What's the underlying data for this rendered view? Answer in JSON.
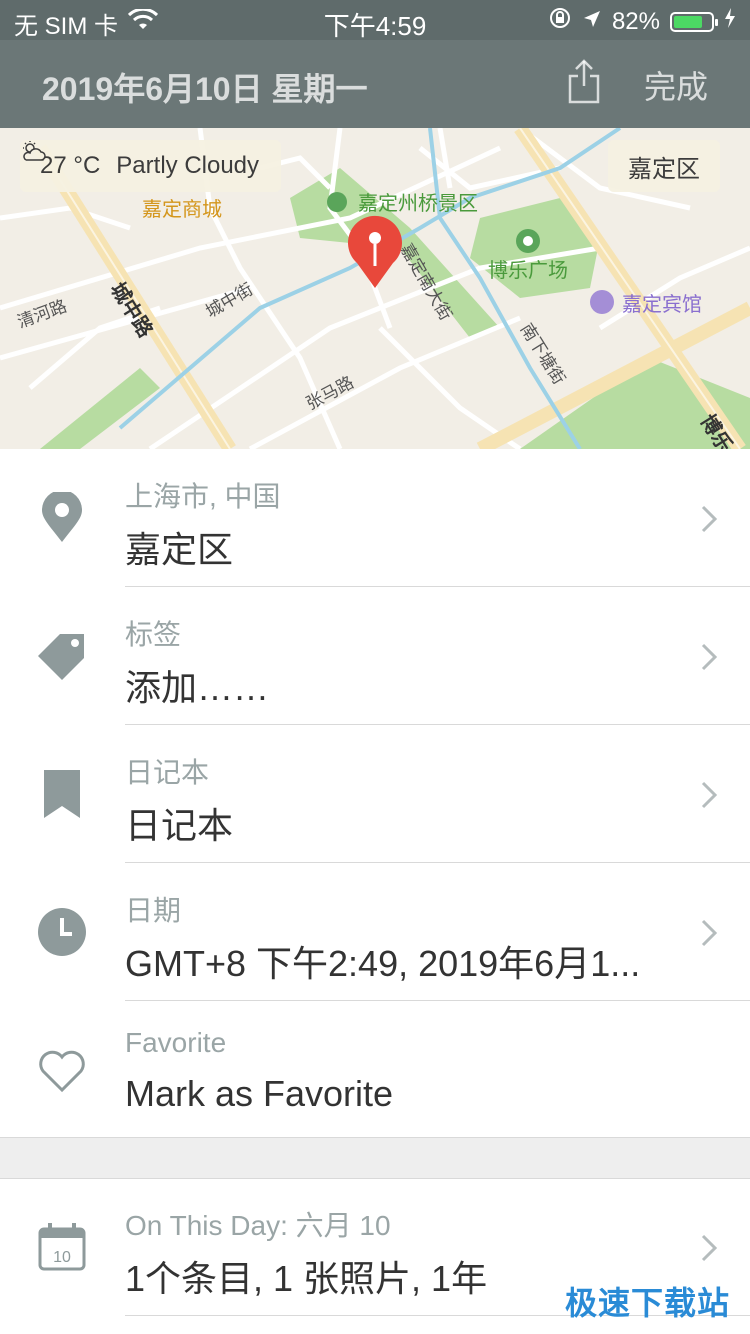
{
  "status_bar": {
    "carrier": "无 SIM 卡",
    "time": "下午4:59",
    "battery_percent": "82%",
    "battery_level": 0.82
  },
  "nav": {
    "title": "2019年6月10日 星期一",
    "done_label": "完成",
    "share_icon": "share-icon"
  },
  "map": {
    "weather": {
      "temperature": "27 °C",
      "condition": "Partly Cloudy",
      "icon": "partly-cloudy-icon"
    },
    "region_label": "嘉定区",
    "labels": {
      "mall": "嘉定商城",
      "scenic": "嘉定州桥景区",
      "square": "博乐广场",
      "hotel": "嘉定宾馆",
      "road_qinghe": "清河路",
      "road_chengzhong": "城中路",
      "street_chengzhong": "城中街",
      "street_jiadingnan": "嘉定南大街",
      "street_nanxiatang": "南下塘街",
      "road_zhangma": "张马路",
      "road_bole": "博乐"
    }
  },
  "rows": [
    {
      "icon": "location-pin-icon",
      "label": "上海市, 中国",
      "value": "嘉定区"
    },
    {
      "icon": "tag-icon",
      "label": "标签",
      "value": "添加……"
    },
    {
      "icon": "bookmark-icon",
      "label": "日记本",
      "value": "日记本"
    },
    {
      "icon": "clock-icon",
      "label": "日期",
      "value": "GMT+8 下午2:49, 2019年6月1..."
    },
    {
      "icon": "heart-icon",
      "label": "Favorite",
      "value": "Mark as Favorite"
    }
  ],
  "on_this_day": {
    "icon": "calendar-icon",
    "calendar_day": "10",
    "label": "On This Day: 六月 10",
    "value": "1个条目, 1 张照片, 1年"
  },
  "watermark": "极速下载站",
  "colors": {
    "nav_bg": "#6b7777",
    "accent_icon": "#8e9a9b",
    "pin_red": "#e8483b",
    "battery_green": "#4cd964"
  }
}
